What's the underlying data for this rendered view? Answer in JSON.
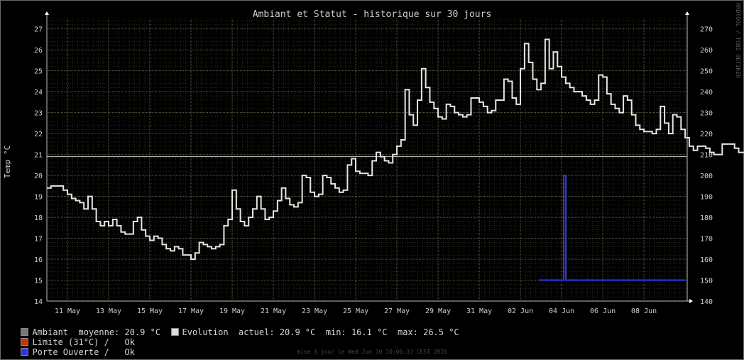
{
  "chart_data": {
    "type": "line",
    "title": "Ambiant et Statut - historique sur 30 jours",
    "ylabel": "Temp °C",
    "ylim": [
      14,
      27.5
    ],
    "y2lim": [
      140,
      275
    ],
    "yticks": [
      "14",
      "15",
      "16",
      "17",
      "18",
      "19",
      "20",
      "21",
      "22",
      "23",
      "24",
      "25",
      "26",
      "27"
    ],
    "y2ticks": [
      "140",
      "150",
      "160",
      "170",
      "180",
      "190",
      "200",
      "210",
      "220",
      "230",
      "240",
      "250",
      "260",
      "270"
    ],
    "x_range_days": [
      0,
      31.1
    ],
    "xticks": [
      {
        "day": 1,
        "label": "11 May"
      },
      {
        "day": 3,
        "label": "13 May"
      },
      {
        "day": 5,
        "label": "15 May"
      },
      {
        "day": 7,
        "label": "17 May"
      },
      {
        "day": 9,
        "label": "19 May"
      },
      {
        "day": 11,
        "label": "21 May"
      },
      {
        "day": 13,
        "label": "23 May"
      },
      {
        "day": 15,
        "label": "25 May"
      },
      {
        "day": 17,
        "label": "27 May"
      },
      {
        "day": 19,
        "label": "29 May"
      },
      {
        "day": 21,
        "label": "31 May"
      },
      {
        "day": 23,
        "label": "02 Jun"
      },
      {
        "day": 25,
        "label": "04 Jun"
      },
      {
        "day": 27,
        "label": "06 Jun"
      },
      {
        "day": 29,
        "label": "08 Jun"
      }
    ],
    "average": 20.9,
    "series": [
      {
        "name": "Evolution",
        "color": "#e6e6e6",
        "step": 0.2,
        "values": [
          19.4,
          19.5,
          19.5,
          19.5,
          19.3,
          19.1,
          18.9,
          18.8,
          18.7,
          18.4,
          19.0,
          18.4,
          17.8,
          17.6,
          17.8,
          17.6,
          17.9,
          17.6,
          17.3,
          17.2,
          17.2,
          17.8,
          18.0,
          17.4,
          17.1,
          16.9,
          17.1,
          17.0,
          16.7,
          16.5,
          16.4,
          16.6,
          16.5,
          16.2,
          16.2,
          16.0,
          16.3,
          16.8,
          16.7,
          16.6,
          16.5,
          16.6,
          16.7,
          17.6,
          17.9,
          19.3,
          18.4,
          17.8,
          17.6,
          18.0,
          18.4,
          19.0,
          18.4,
          17.9,
          18.0,
          18.3,
          18.8,
          19.4,
          18.9,
          18.6,
          18.5,
          18.7,
          20.0,
          19.9,
          19.2,
          19.0,
          19.1,
          20.0,
          19.9,
          19.6,
          19.4,
          19.2,
          19.3,
          20.5,
          20.8,
          20.2,
          20.1,
          20.1,
          20.0,
          20.7,
          21.1,
          20.9,
          20.7,
          20.6,
          21.0,
          21.4,
          21.7,
          24.1,
          22.9,
          22.4,
          23.6,
          25.1,
          24.2,
          23.5,
          23.2,
          22.8,
          22.7,
          23.4,
          23.3,
          23.0,
          22.9,
          22.8,
          22.9,
          23.7,
          23.7,
          23.5,
          23.3,
          23.0,
          23.1,
          23.6,
          23.6,
          24.6,
          24.5,
          23.7,
          23.4,
          25.1,
          26.3,
          25.4,
          24.6,
          24.1,
          24.4,
          26.5,
          25.1,
          25.9,
          25.2,
          24.7,
          24.4,
          24.2,
          24.0,
          24.0,
          23.8,
          23.6,
          23.4,
          23.6,
          24.8,
          24.7,
          23.9,
          23.4,
          23.2,
          23.0,
          23.8,
          23.6,
          22.9,
          22.4,
          22.2,
          22.1,
          22.1,
          22.0,
          22.2,
          23.3,
          22.5,
          22.0,
          22.9,
          22.8,
          22.2,
          21.8,
          21.4,
          21.2,
          21.4,
          21.4,
          21.3,
          21.1,
          21.0,
          21.0,
          21.5,
          21.5,
          21.5,
          21.3,
          21.1,
          21.1,
          21.5,
          21.5,
          21.5,
          21.3,
          21.2,
          21.2,
          21.5,
          21.5,
          21.4,
          21.3,
          21.2,
          21.2,
          21.2,
          21.4,
          21.4,
          21.3,
          21.1,
          20.9
        ]
      },
      {
        "name": "Porte Ouverte",
        "color": "#3333ff",
        "axis": "right",
        "points": [
          [
            23.9,
            150
          ],
          [
            25.1,
            150
          ],
          [
            25.1,
            200
          ],
          [
            25.2,
            200
          ],
          [
            25.2,
            150
          ],
          [
            31.0,
            150
          ]
        ]
      }
    ]
  },
  "legend": [
    {
      "swatch": "#777777",
      "text": "Ambiant  moyenne: 20.9 °C"
    },
    {
      "swatch": "#dcdcdc",
      "text": "Evolution  actuel: 20.9 °C  min: 16.1 °C  max: 26.5 °C"
    },
    {
      "swatch": "#cc3300",
      "text": "Limite (31°C) /   Ok"
    },
    {
      "swatch": "#3333ee",
      "text": "Porte Ouverte /   Ok"
    }
  ],
  "footer": "mise à jour le Wed Jun 10 10:06:33 CEST 2026",
  "watermark": "RRDTOOL / TOBI OETIKER"
}
